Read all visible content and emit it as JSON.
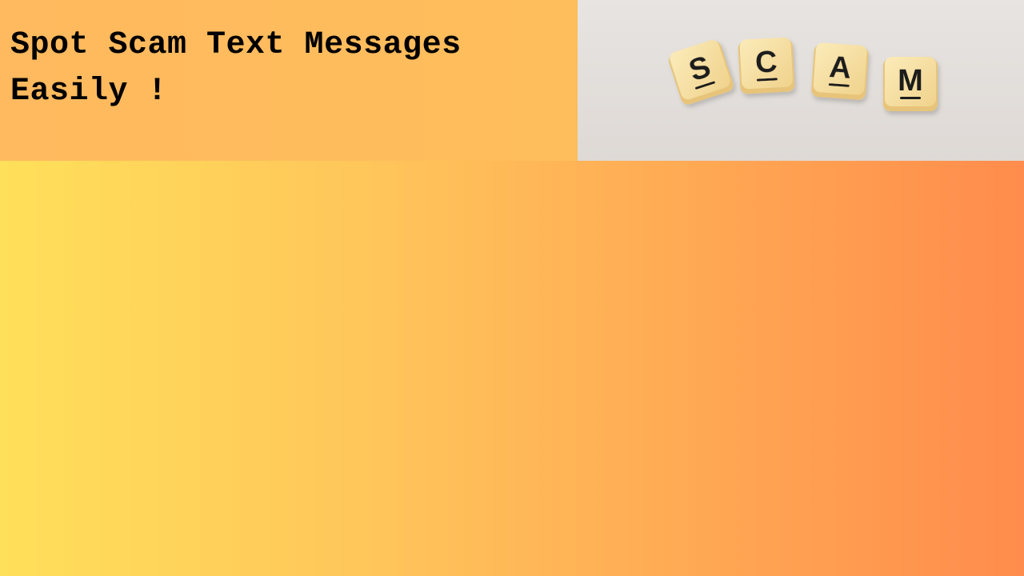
{
  "slide": {
    "headline": "Spot Scam Text Messages Easily !"
  },
  "photo": {
    "tiles": [
      "S",
      "C",
      "A",
      "M"
    ]
  },
  "colors": {
    "gradient_left": "#FFE05A",
    "gradient_right": "#FF8C4C",
    "header_band": "#FFBB5D",
    "photo_background": "#E4E0DD",
    "tile_face": "#F6DFA2",
    "tile_edge": "#E9C97E",
    "letter": "#1B1B1B"
  }
}
